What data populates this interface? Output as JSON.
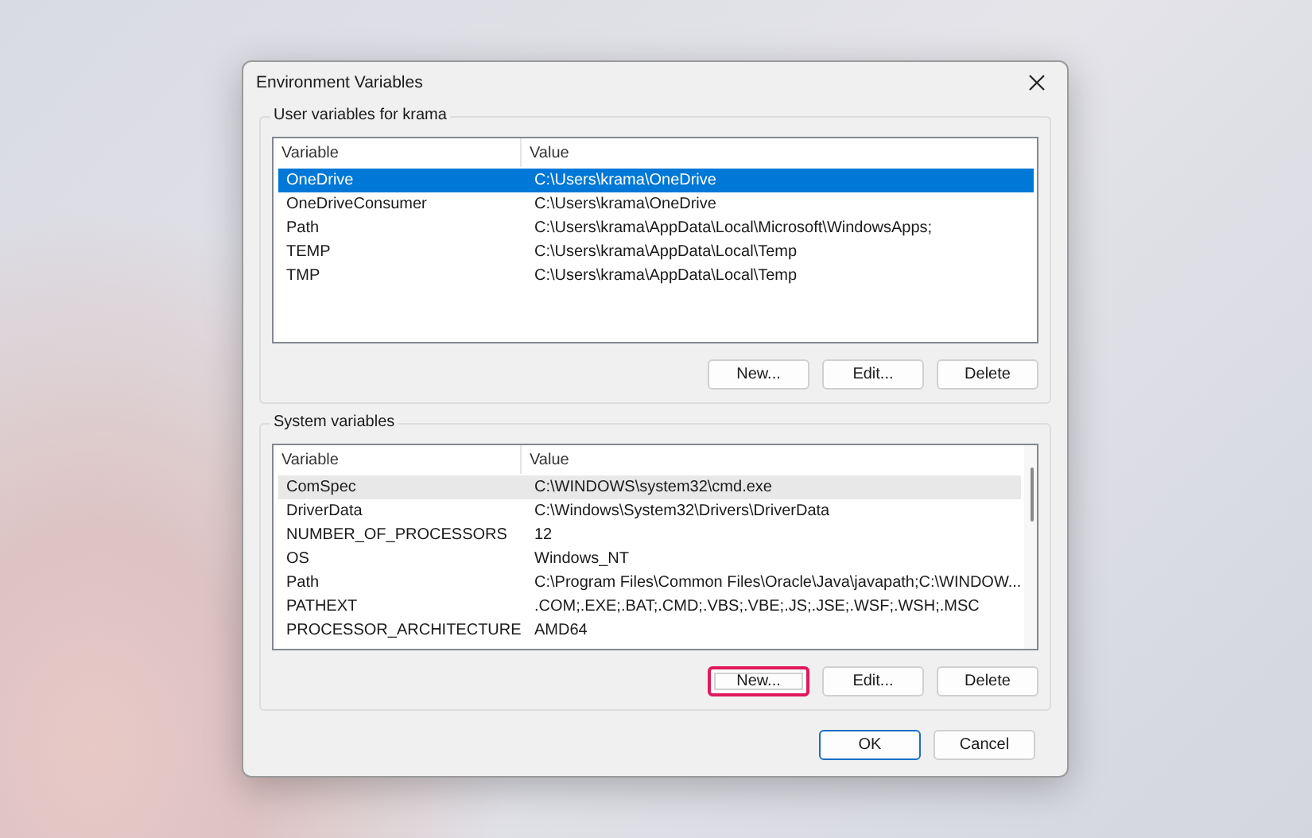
{
  "window": {
    "title": "Environment Variables"
  },
  "groups": [
    {
      "title": "User variables for krama",
      "focused": true,
      "columns": [
        "Variable",
        "Value"
      ],
      "rows": [
        {
          "variable": "OneDrive",
          "value": "C:\\Users\\krama\\OneDrive",
          "selected": true
        },
        {
          "variable": "OneDriveConsumer",
          "value": "C:\\Users\\krama\\OneDrive",
          "selected": false
        },
        {
          "variable": "Path",
          "value": "C:\\Users\\krama\\AppData\\Local\\Microsoft\\WindowsApps;",
          "selected": false
        },
        {
          "variable": "TEMP",
          "value": "C:\\Users\\krama\\AppData\\Local\\Temp",
          "selected": false
        },
        {
          "variable": "TMP",
          "value": "C:\\Users\\krama\\AppData\\Local\\Temp",
          "selected": false
        }
      ],
      "buttons": [
        {
          "label": "New...",
          "highlighted": false
        },
        {
          "label": "Edit...",
          "highlighted": false
        },
        {
          "label": "Delete",
          "highlighted": false
        }
      ]
    },
    {
      "title": "System variables",
      "focused": false,
      "columns": [
        "Variable",
        "Value"
      ],
      "rows": [
        {
          "variable": "ComSpec",
          "value": "C:\\WINDOWS\\system32\\cmd.exe",
          "selected": true
        },
        {
          "variable": "DriverData",
          "value": "C:\\Windows\\System32\\Drivers\\DriverData",
          "selected": false
        },
        {
          "variable": "NUMBER_OF_PROCESSORS",
          "value": "12",
          "selected": false
        },
        {
          "variable": "OS",
          "value": "Windows_NT",
          "selected": false
        },
        {
          "variable": "Path",
          "value": "C:\\Program Files\\Common Files\\Oracle\\Java\\javapath;C:\\WINDOW...",
          "selected": false
        },
        {
          "variable": "PATHEXT",
          "value": ".COM;.EXE;.BAT;.CMD;.VBS;.VBE;.JS;.JSE;.WSF;.WSH;.MSC",
          "selected": false
        },
        {
          "variable": "PROCESSOR_ARCHITECTURE",
          "value": "AMD64",
          "selected": false
        }
      ],
      "buttons": [
        {
          "label": "New...",
          "highlighted": true
        },
        {
          "label": "Edit...",
          "highlighted": false
        },
        {
          "label": "Delete",
          "highlighted": false
        }
      ]
    }
  ],
  "footer_buttons": [
    {
      "label": "OK",
      "default": true
    },
    {
      "label": "Cancel",
      "default": false
    }
  ]
}
